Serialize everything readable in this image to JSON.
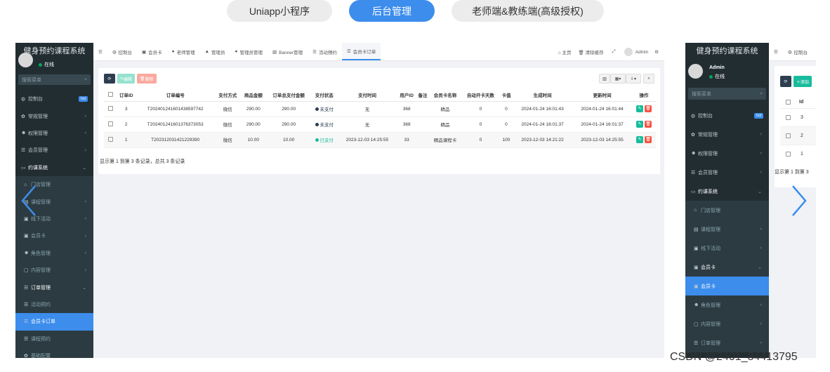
{
  "tabs": [
    "Uniapp小程序",
    "后台管理",
    "老师端&教练端(高级授权)"
  ],
  "left": {
    "sidebar_title": "健身预约课程系统",
    "status": "在线",
    "search_placeholder": "搜索菜单",
    "menu": [
      {
        "icon": "dashboard-icon",
        "glyph": "◍",
        "label": "控制台",
        "badge": "hot"
      },
      {
        "icon": "gears-icon",
        "glyph": "✿",
        "label": "常规管理",
        "arrow": "‹"
      },
      {
        "icon": "users-icon",
        "glyph": "☻",
        "label": "权限管理",
        "arrow": "‹"
      },
      {
        "icon": "list-icon",
        "glyph": "☰",
        "label": "会员管理",
        "arrow": "‹"
      },
      {
        "icon": "folder-icon",
        "glyph": "▭",
        "label": "约课系统",
        "arrow": "⌄",
        "open": true
      },
      {
        "icon": "bank-icon",
        "glyph": "⌂",
        "label": "门店管理",
        "sub": true
      },
      {
        "icon": "book-icon",
        "glyph": "▤",
        "label": "课程管理",
        "sub": true,
        "arrow": "‹"
      },
      {
        "icon": "card-icon",
        "glyph": "▣",
        "label": "线下活动",
        "sub": true,
        "arrow": "‹"
      },
      {
        "icon": "card-icon",
        "glyph": "▣",
        "label": "会员卡",
        "sub": true,
        "arrow": "‹"
      },
      {
        "icon": "users-icon",
        "glyph": "☻",
        "label": "角色管理",
        "sub": true,
        "arrow": "‹"
      },
      {
        "icon": "file-icon",
        "glyph": "▢",
        "label": "内容管理",
        "sub": true,
        "arrow": "‹"
      },
      {
        "icon": "list-icon",
        "glyph": "☰",
        "label": "订单管理",
        "sub": true,
        "arrow": "⌄",
        "open": true
      },
      {
        "icon": "list-icon",
        "glyph": "☰",
        "label": "活动预约",
        "sub": true
      },
      {
        "icon": "list-icon",
        "glyph": "☰",
        "label": "会员卡订单",
        "sub": true,
        "active": true
      },
      {
        "icon": "list-icon",
        "glyph": "☰",
        "label": "课程预约",
        "sub": true
      },
      {
        "icon": "gear-icon",
        "glyph": "✿",
        "label": "基础配置",
        "sub": true
      }
    ],
    "topnav": [
      {
        "icon": "dashboard-icon",
        "glyph": "◍",
        "label": "控制台"
      },
      {
        "icon": "card-icon",
        "glyph": "▣",
        "label": "会员卡"
      },
      {
        "icon": "user-icon",
        "glyph": "●",
        "label": "老师管理"
      },
      {
        "icon": "graduation-icon",
        "glyph": "▲",
        "label": "管理员"
      },
      {
        "icon": "user-icon",
        "glyph": "●",
        "label": "管理员管理"
      },
      {
        "icon": "image-icon",
        "glyph": "▧",
        "label": "Banner管理"
      },
      {
        "icon": "list-icon",
        "glyph": "☰",
        "label": "活动预约"
      },
      {
        "icon": "list-icon",
        "glyph": "☰",
        "label": "会员卡订单",
        "active": true
      }
    ],
    "topright": {
      "home": "主页",
      "clear": "清除缓存",
      "admin": "Admin"
    },
    "toolbar": {
      "edit": "编辑",
      "delete": "删除"
    },
    "columns": [
      "订单ID",
      "订单编号",
      "支付方式",
      "商品金额",
      "订单总支付金额",
      "支付状态",
      "支付时间",
      "用户ID",
      "备注",
      "会员卡名称",
      "自动开卡天数",
      "卡值",
      "生成时间",
      "更新时间",
      "操作"
    ],
    "rows": [
      [
        "3",
        "T202401241601438597742",
        "微信",
        "290.00",
        "290.00",
        "未支付",
        "无",
        "368",
        "",
        "精品",
        "0",
        "0",
        "2024-01-24 16:01:43",
        "2024-01-24 16:01:44"
      ],
      [
        "2",
        "T202401241601376373053",
        "微信",
        "290.00",
        "290.00",
        "未支付",
        "无",
        "368",
        "",
        "精品",
        "0",
        "0",
        "2024-01-24 16:01:37",
        "2024-01-24 16:01:37"
      ],
      [
        "1",
        "T202312031421229390",
        "微信",
        "10.00",
        "10.00",
        "已支付",
        "2023-12-03 14:25:55",
        "33",
        "",
        "精品课程卡",
        "0",
        "100",
        "2023-12-03 14:21:22",
        "2023-12-03 14:25:55"
      ]
    ],
    "row_status_colors": [
      "#2c3e50",
      "#2c3e50",
      "#18bc9c"
    ],
    "footer": "显示第 1 到第 3 条记录，总共 3 条记录"
  },
  "right": {
    "sidebar_title": "健身预约课程系统",
    "user": "Admin",
    "status": "在线",
    "search_placeholder": "搜索菜单",
    "menu": [
      {
        "icon": "dashboard-icon",
        "glyph": "◍",
        "label": "控制台",
        "badge": "hot"
      },
      {
        "icon": "gears-icon",
        "glyph": "✿",
        "label": "常规管理",
        "arrow": "‹"
      },
      {
        "icon": "users-icon",
        "glyph": "☻",
        "label": "权限管理",
        "arrow": "‹"
      },
      {
        "icon": "list-icon",
        "glyph": "☰",
        "label": "会员管理",
        "arrow": "‹"
      },
      {
        "icon": "folder-icon",
        "glyph": "▭",
        "label": "约课系统",
        "arrow": "⌄",
        "open": true
      },
      {
        "icon": "bank-icon",
        "glyph": "⌂",
        "label": "门店管理",
        "sub": true
      },
      {
        "icon": "book-icon",
        "glyph": "▤",
        "label": "课程管理",
        "sub": true,
        "arrow": "‹"
      },
      {
        "icon": "card-icon",
        "glyph": "▣",
        "label": "线下活动",
        "sub": true,
        "arrow": "‹"
      },
      {
        "icon": "card-icon",
        "glyph": "▣",
        "label": "会员卡",
        "sub": true,
        "arrow": "⌄",
        "open": true
      },
      {
        "icon": "card-icon",
        "glyph": "▣",
        "label": "会员卡",
        "sub": true,
        "active": true
      },
      {
        "icon": "users-icon",
        "glyph": "☻",
        "label": "角色管理",
        "sub": true,
        "arrow": "‹"
      },
      {
        "icon": "file-icon",
        "glyph": "▢",
        "label": "内容管理",
        "sub": true,
        "arrow": "‹"
      },
      {
        "icon": "list-icon",
        "glyph": "☰",
        "label": "订单管理",
        "sub": true,
        "arrow": "‹"
      }
    ],
    "topnav": [
      {
        "icon": "dashboard-icon",
        "glyph": "◍",
        "label": "控制台"
      }
    ],
    "add": "添加",
    "col": "Id",
    "ids": [
      "3",
      "2",
      "1"
    ],
    "footer": "显示第 1 到第 3"
  },
  "watermark": "CSDN @2401_84413795",
  "colors": {
    "accent": "#3c8dec",
    "sidebar": "#222d32",
    "green": "#18bc9c",
    "red": "#f75444"
  }
}
